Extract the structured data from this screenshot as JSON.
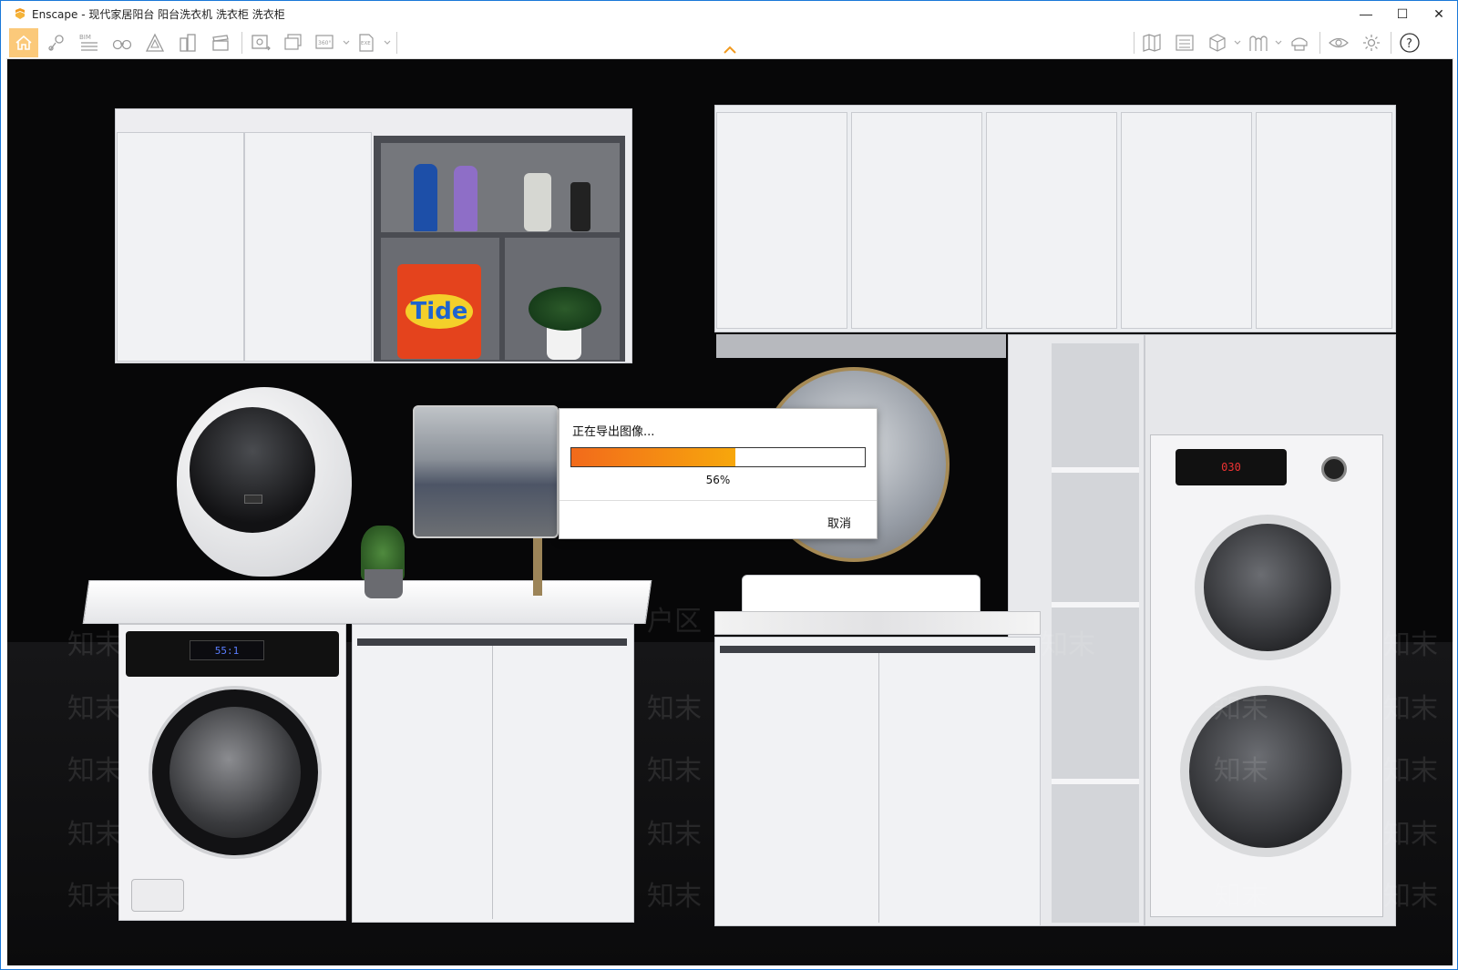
{
  "window": {
    "title": "Enscape - 现代家居阳台 阳台洗衣机 洗衣柜 洗衣柜",
    "controls": {
      "minimize": "—",
      "maximize": "☐",
      "close": "✕"
    }
  },
  "toolbar": {
    "left_icons": [
      "home-icon",
      "orbit-icon",
      "bim-icon",
      "binoculars-icon",
      "atlas-icon",
      "buildings-icon",
      "clapper-icon",
      "screenshot-icon",
      "batch-render-icon",
      "panorama-360-icon",
      "export-exe-icon"
    ],
    "bim_label": "BIM",
    "pano_label": "360°",
    "exe_label": "EXE",
    "right_icons": [
      "map-icon",
      "media-icon",
      "cube-view-icon",
      "library-icon",
      "hat-icon",
      "eye-icon",
      "settings-icon",
      "help-icon"
    ],
    "help_label": "?"
  },
  "dialog": {
    "title": "正在导出图像...",
    "progress": 0.56,
    "percent_label": "56%",
    "cancel_label": "取消"
  },
  "scene": {
    "watermark_text": "知末",
    "watermark_text_2": "户区",
    "washer_display": "55:1",
    "tower_display": "030",
    "brand_label": "Tide"
  },
  "colors": {
    "accent": "#fbc97a",
    "progress_start": "#f26a1b",
    "progress_end": "#f7a70c",
    "frame": "#1a78d8"
  }
}
